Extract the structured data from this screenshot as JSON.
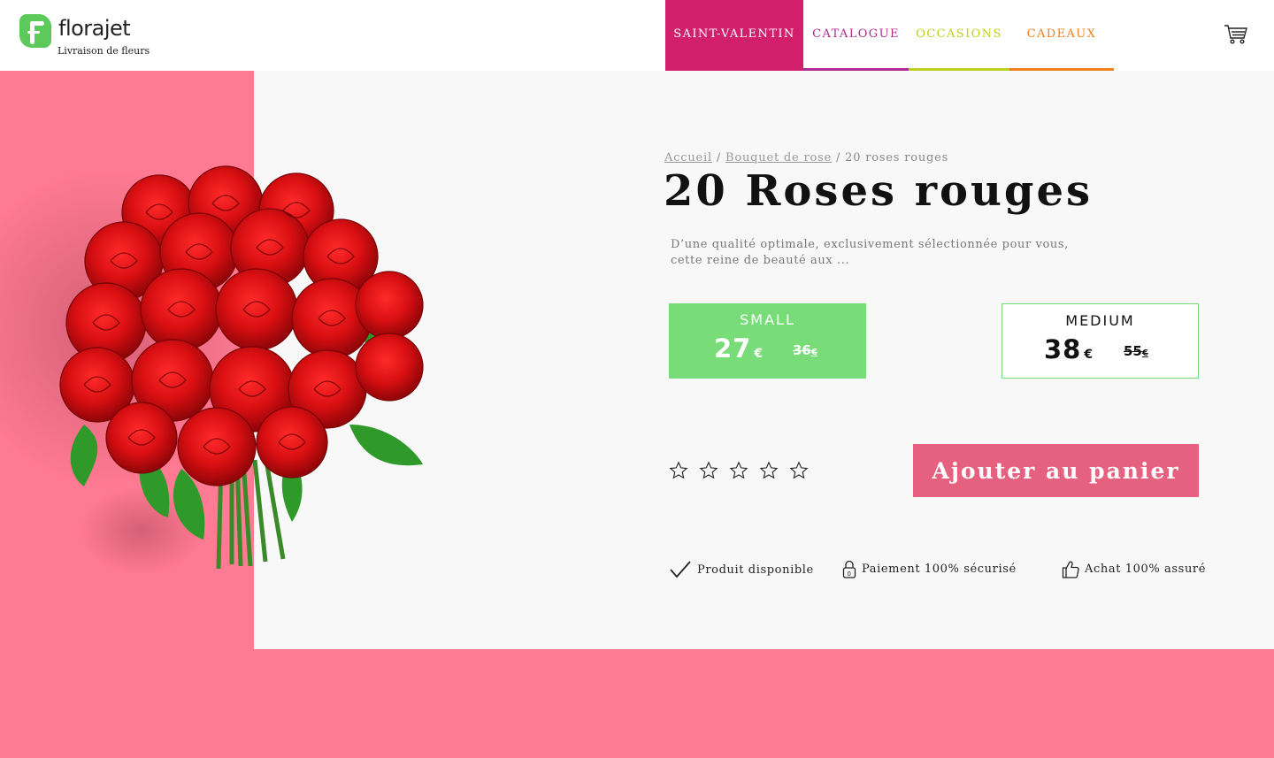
{
  "header": {
    "logo": {
      "name": "florajet",
      "tagline": "Livraison de fleurs"
    },
    "nav": [
      {
        "label": "SAINT-VALENTIN",
        "color": "#d21f6c"
      },
      {
        "label": "CATALOGUE",
        "color": "#b02a8e"
      },
      {
        "label": "OCCASIONS",
        "color": "#bcd11c"
      },
      {
        "label": "CADEAUX",
        "color": "#f07f1c"
      }
    ],
    "cart_icon": "cart-icon"
  },
  "breadcrumb": {
    "home": "Accueil",
    "separator": "/",
    "category": "Bouquet de rose",
    "current": "20 roses rouges"
  },
  "product": {
    "title": "20 Roses rouges",
    "description": "D’une qualité optimale, exclusivement sélectionnée pour vous, cette reine de beauté aux ...",
    "sizes": [
      {
        "name": "SMALL",
        "price": "27",
        "currency": "€",
        "old_price": "36",
        "old_currency": "€",
        "selected": true
      },
      {
        "name": "MEDIUM",
        "price": "38",
        "currency": "€",
        "old_price": "55",
        "old_currency": "€",
        "selected": false
      }
    ],
    "rating": {
      "value": 0,
      "max": 5
    },
    "add_to_cart": "Ajouter au panier"
  },
  "features": [
    {
      "icon": "check-icon",
      "label": "Produit disponible"
    },
    {
      "icon": "lock-icon",
      "label": "Paiement 100% sécurisé"
    },
    {
      "icon": "thumbs-up-icon",
      "label": "Achat 100% assuré"
    }
  ],
  "colors": {
    "background_pink": "#ff7a92",
    "accent_green": "#78dc78",
    "button_pink": "#e5617f"
  }
}
